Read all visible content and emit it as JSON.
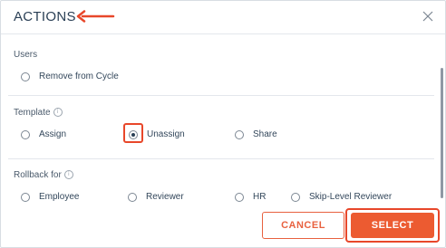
{
  "header": {
    "title": "ACTIONS"
  },
  "sections": {
    "users": {
      "label": "Users",
      "options": [
        "Remove from Cycle"
      ]
    },
    "template": {
      "label": "Template",
      "options": [
        "Assign",
        "Unassign",
        "Share"
      ],
      "selected": "Unassign"
    },
    "rollback": {
      "label": "Rollback for",
      "options": [
        "Employee",
        "Reviewer",
        "HR",
        "Skip-Level Reviewer"
      ]
    }
  },
  "footer": {
    "cancel_label": "CANCEL",
    "select_label": "SELECT"
  },
  "colors": {
    "accent": "#ec5b31",
    "annotation": "#e8472a",
    "text": "#33475b"
  },
  "icons": {
    "close": "close-icon",
    "info": "info-icon",
    "arrow": "arrow-left-icon"
  }
}
